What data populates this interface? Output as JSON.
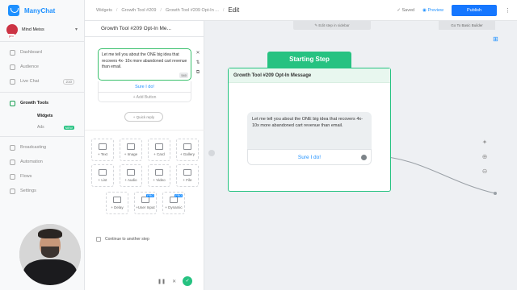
{
  "app": {
    "name": "ManyChat"
  },
  "account": {
    "name": "Mind Meiss"
  },
  "nav": {
    "items": [
      {
        "label": "Dashboard"
      },
      {
        "label": "Audience"
      },
      {
        "label": "Live Chat",
        "badge": "210"
      },
      {
        "label": "Growth Tools"
      },
      {
        "label": "Broadcasting"
      },
      {
        "label": "Automation"
      },
      {
        "label": "Flows"
      },
      {
        "label": "Settings"
      }
    ],
    "sub": [
      {
        "label": "Widgets"
      },
      {
        "label": "Ads",
        "tag": "NEW"
      }
    ]
  },
  "topbar": {
    "crumbs": [
      "Widgets",
      "Growth Tool #209",
      "Growth Tool #209 Opt-In ..."
    ],
    "current": "Edit",
    "saved": "Saved",
    "preview": "Preview",
    "publish": "Publish",
    "more": "⋮"
  },
  "editor": {
    "title": "Growth Tool #209 Opt-In Me...",
    "message": "Let me tell you about the ONE big idea that recovers 4x- 10x more abandoned cart revenue than email.",
    "counter": "540",
    "reply_button": "Sure I do!",
    "add_button": "+ Add Button",
    "quick_reply": "+ Quick reply",
    "tools": [
      {
        "label": "+ Text"
      },
      {
        "label": "+ Image"
      },
      {
        "label": "+ Card"
      },
      {
        "label": "+ Gallery"
      },
      {
        "label": "+ List"
      },
      {
        "label": "+ Audio"
      },
      {
        "label": "+ Video"
      },
      {
        "label": "+ File"
      },
      {
        "label": "+ Delay"
      },
      {
        "label": "+User Input",
        "pro": "PRO"
      },
      {
        "label": "+ Dynamic",
        "pro": "PRO"
      }
    ],
    "continue": "Continue to another step"
  },
  "canvas": {
    "edit_in_sidebar": "Edit step in sidebar",
    "basic_builder": "Go To Basic Builder",
    "start_label": "Starting Step",
    "node_title": "Growth Tool #209 Opt-In Message",
    "bubble_text": "Let me tell you about the ONE big idea that recovers 4x- 10x more abandoned cart revenue than email.",
    "bubble_button": "Sure I do!"
  },
  "colors": {
    "accent": "#1677ff",
    "green": "#26c281"
  },
  "icons": [
    "logo-icon",
    "dashboard-icon",
    "audience-icon",
    "chat-icon",
    "growth-icon",
    "broadcast-icon",
    "automation-icon",
    "flows-icon",
    "settings-icon",
    "close-icon",
    "pin-icon"
  ]
}
